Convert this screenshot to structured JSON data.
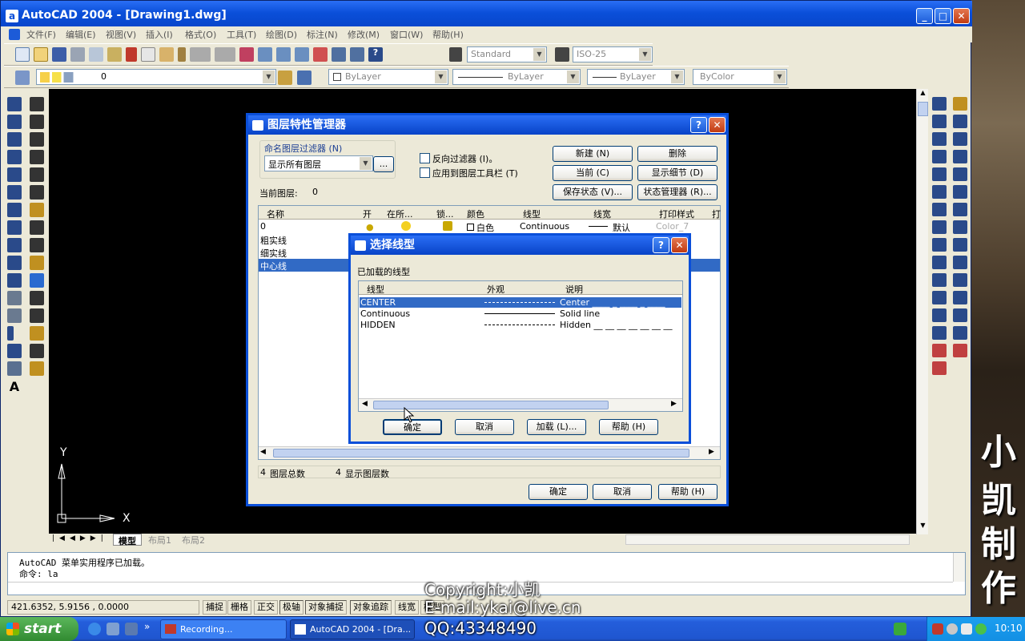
{
  "window": {
    "title": "AutoCAD 2004 - [Drawing1.dwg]",
    "app_icon": "a"
  },
  "menu": [
    "文件(F)",
    "编辑(E)",
    "视图(V)",
    "插入(I)",
    "格式(O)",
    "工具(T)",
    "绘图(D)",
    "标注(N)",
    "修改(M)",
    "窗口(W)",
    "帮助(H)"
  ],
  "toolbar": {
    "text_style": "Standard",
    "dim_style": "ISO-25",
    "layer_value": "0",
    "color": "ByLayer",
    "linetype": "ByLayer",
    "lineweight": "ByLayer",
    "plotstyle": "ByColor"
  },
  "layout_tabs": [
    "模型",
    "布局1",
    "布局2"
  ],
  "ucs": {
    "x": "X",
    "y": "Y"
  },
  "command": {
    "line1": "AutoCAD 菜单实用程序已加载。",
    "line2": "命令: la"
  },
  "status": {
    "coords": "421.6352, 5.9156 , 0.0000",
    "buttons": [
      "捕捉",
      "栅格",
      "正交",
      "极轴",
      "对象捕捉",
      "对象追踪",
      "线宽",
      "模型"
    ]
  },
  "layer_dialog": {
    "title": "图层特性管理器",
    "filter_label": "命名图层过滤器 (N)",
    "filter_value": "显示所有图层",
    "filter_more": "...",
    "invert_filter": "反向过滤器 (I)。",
    "apply_toolbar": "应用到图层工具栏 (T)",
    "current_layer_label": "当前图层:",
    "current_layer_value": "0",
    "btn_new": "新建 (N)",
    "btn_delete": "删除",
    "btn_current": "当前 (C)",
    "btn_details": "显示细节 (D)",
    "btn_save_state": "保存状态 (V)...",
    "btn_state_mgr": "状态管理器 (R)...",
    "columns": [
      "名称",
      "开",
      "在所...",
      "锁...",
      "颜色",
      "线型",
      "线宽",
      "打印样式",
      "打"
    ],
    "rows": [
      {
        "name": "0",
        "color": "白色",
        "linetype": "Continuous",
        "lineweight": "默认",
        "plotstyle": "Color_7"
      },
      {
        "name": "粗实线"
      },
      {
        "name": "细实线"
      },
      {
        "name": "中心线"
      }
    ],
    "total_count": "4",
    "total_label": "图层总数",
    "shown_count": "4",
    "shown_label": "显示图层数",
    "btn_ok": "确定",
    "btn_cancel": "取消",
    "btn_help": "帮助 (H)"
  },
  "linetype_dialog": {
    "title": "选择线型",
    "loaded_label": "已加载的线型",
    "columns": [
      "线型",
      "外观",
      "说明"
    ],
    "rows": [
      {
        "name": "CENTER",
        "desc": "Center ____ _ ____ _ ____"
      },
      {
        "name": "Continuous",
        "desc": "Solid line"
      },
      {
        "name": "HIDDEN",
        "desc": "Hidden __ __ __ __ __ __ __"
      }
    ],
    "btn_ok": "确定",
    "btn_cancel": "取消",
    "btn_load": "加载 (L)...",
    "btn_help": "帮助 (H)"
  },
  "watermark": {
    "copyright": "Copyright:小凯",
    "email": "E-mail:ykai@live.cn",
    "qq": "QQ:43348490"
  },
  "side_art": [
    "小",
    "凯",
    "制",
    "作"
  ],
  "taskbar": {
    "start": "start",
    "tasks": [
      "Recording...",
      "AutoCAD 2004 - [Dra..."
    ],
    "clock": "10:10"
  }
}
